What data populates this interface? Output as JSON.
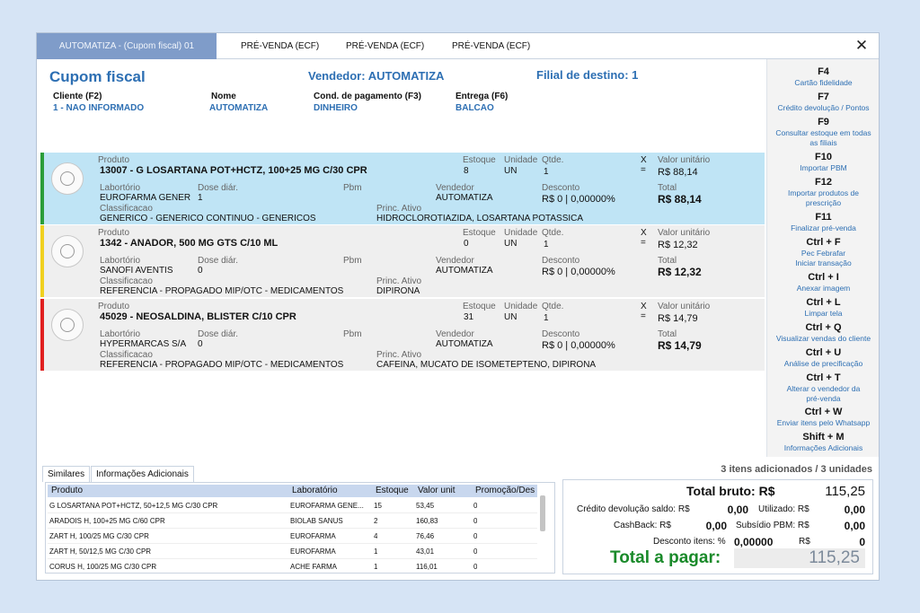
{
  "tabs": [
    "AUTOMATIZA - (Cupom fiscal) 01",
    "PRÉ-VENDA (ECF)",
    "PRÉ-VENDA (ECF)",
    "PRÉ-VENDA (ECF)"
  ],
  "header": {
    "title": "Cupom fiscal",
    "vendedor": "Vendedor: AUTOMATIZA",
    "filial": "Filial de destino:  1",
    "fields": [
      {
        "label": "Cliente (F2)",
        "value": "1 - NAO INFORMADO"
      },
      {
        "label": "Nome",
        "value": "AUTOMATIZA"
      },
      {
        "label": "Cond. de pagamento (F3)",
        "value": "DINHEIRO"
      },
      {
        "label": "Entrega (F6)",
        "value": "BALCAO"
      }
    ]
  },
  "labels": {
    "produto": "Produto",
    "estoque": "Estoque",
    "unidade": "Unidade",
    "qtde": "Qtde.",
    "x": "X",
    "eq": "=",
    "valor_unit": "Valor unitário",
    "laboratorio": "Labortório",
    "dose": "Dose diár.",
    "pbm": "Pbm",
    "vendedor": "Vendedor",
    "desconto": "Desconto",
    "total": "Total",
    "classificacao": "Classificacao",
    "princ_ativo": "Princ. Ativo"
  },
  "products": [
    {
      "name": "13007 - G LOSARTANA POT+HCTZ, 100+25 MG C/30 CPR",
      "estoque": "8",
      "unidade": "UN",
      "qtde": "1",
      "valor_unit": "R$ 88,14",
      "laboratorio": "EUROFARMA GENER",
      "dose": "1",
      "vendedor": "AUTOMATIZA",
      "desconto": "R$ 0 | 0,00000%",
      "total": "R$ 88,14",
      "classificacao": "GENERICO - GENERICO CONTINUO - GENERICOS",
      "princ_ativo": "HIDROCLOROTIAZIDA, LOSARTANA POTASSICA",
      "color": "#2a9d3a"
    },
    {
      "name": "1342 - ANADOR, 500 MG GTS C/10 ML",
      "estoque": "0",
      "unidade": "UN",
      "qtde": "1",
      "valor_unit": "R$ 12,32",
      "laboratorio": "SANOFI AVENTIS",
      "dose": "0",
      "vendedor": "AUTOMATIZA",
      "desconto": "R$ 0 | 0,00000%",
      "total": "R$ 12,32",
      "classificacao": "REFERENCIA - PROPAGADO MIP/OTC  - MEDICAMENTOS",
      "princ_ativo": "DIPIRONA",
      "color": "#f0d020"
    },
    {
      "name": "45029 - NEOSALDINA, BLISTER C/10 CPR",
      "estoque": "31",
      "unidade": "UN",
      "qtde": "1",
      "valor_unit": "R$ 14,79",
      "laboratorio": "HYPERMARCAS S/A",
      "dose": "0",
      "vendedor": "AUTOMATIZA",
      "desconto": "R$ 0 | 0,00000%",
      "total": "R$ 14,79",
      "classificacao": "REFERENCIA - PROPAGADO MIP/OTC  - MEDICAMENTOS",
      "princ_ativo": "CAFEINA, MUCATO DE ISOMETEPTENO, DIPIRONA",
      "color": "#e02020"
    }
  ],
  "shortcuts": [
    {
      "key": "F4",
      "desc": [
        "Cartão fidelidade"
      ]
    },
    {
      "key": "F7",
      "desc": [
        "Crédito devolução / Pontos"
      ]
    },
    {
      "key": "F9",
      "desc": [
        "Consultar estoque em todas",
        "as filiais"
      ]
    },
    {
      "key": "F10",
      "desc": [
        "Importar PBM"
      ]
    },
    {
      "key": "F12",
      "desc": [
        "Importar produtos de",
        "prescrição"
      ]
    },
    {
      "key": "F11",
      "desc": [
        "Finalizar pré-venda"
      ]
    },
    {
      "key": "Ctrl + F",
      "desc": [
        "Pec Febrafar",
        "Iniciar transação"
      ]
    },
    {
      "key": "Ctrl + I",
      "desc": [
        "Anexar imagem"
      ]
    },
    {
      "key": "Ctrl + L",
      "desc": [
        "Limpar tela"
      ]
    },
    {
      "key": "Ctrl + Q",
      "desc": [
        "Visualizar vendas do cliente"
      ]
    },
    {
      "key": "Ctrl + U",
      "desc": [
        "Análise de precificação"
      ]
    },
    {
      "key": "Ctrl + T",
      "desc": [
        "Alterar o vendedor da",
        "pré-venda"
      ]
    },
    {
      "key": "Ctrl + W",
      "desc": [
        "Enviar itens pelo Whatsapp"
      ]
    },
    {
      "key": "Shift + M",
      "desc": [
        "Informações Adicionais"
      ]
    }
  ],
  "bottom_tabs": [
    "Similares",
    "Informações Adicionais"
  ],
  "similares": {
    "columns": [
      "Produto",
      "Laboratório",
      "Estoque",
      "Valor unit",
      "Promoção/Des"
    ],
    "rows": [
      [
        "G LOSARTANA POT+HCTZ, 50+12,5 MG C/30 CPR",
        "EUROFARMA GENE...",
        "15",
        "53,45",
        "0"
      ],
      [
        "ARADOIS H, 100+25 MG C/60 CPR",
        "BIOLAB SANUS",
        "2",
        "160,83",
        "0"
      ],
      [
        "ZART H, 100/25 MG C/30 CPR",
        "EUROFARMA",
        "4",
        "76,46",
        "0"
      ],
      [
        "ZART H, 50/12,5 MG C/30 CPR",
        "EUROFARMA",
        "1",
        "43,01",
        "0"
      ],
      [
        "CORUS H, 100/25 MG C/30 CPR",
        "ACHE FARMA",
        "1",
        "116,01",
        "0"
      ]
    ]
  },
  "totals": {
    "summary": "3 itens adicionados / 3 unidades",
    "bruto_label": "Total bruto: R$",
    "bruto_value": "115,25",
    "credito_label": "Crédito devolução saldo: R$",
    "credito_value": "0,00",
    "utilizado_label": "Utilizado: R$",
    "utilizado_value": "0,00",
    "cashback_label": "CashBack: R$",
    "cashback_value": "0,00",
    "subsidio_label": "Subsídio PBM: R$",
    "subsidio_value": "0,00",
    "desconto_label": "Desconto itens: %",
    "desconto_value": "0,00000",
    "desconto_rs_label": "R$",
    "desconto_rs_value": "0",
    "pagar_label": "Total a pagar:",
    "pagar_value": "115,25"
  }
}
